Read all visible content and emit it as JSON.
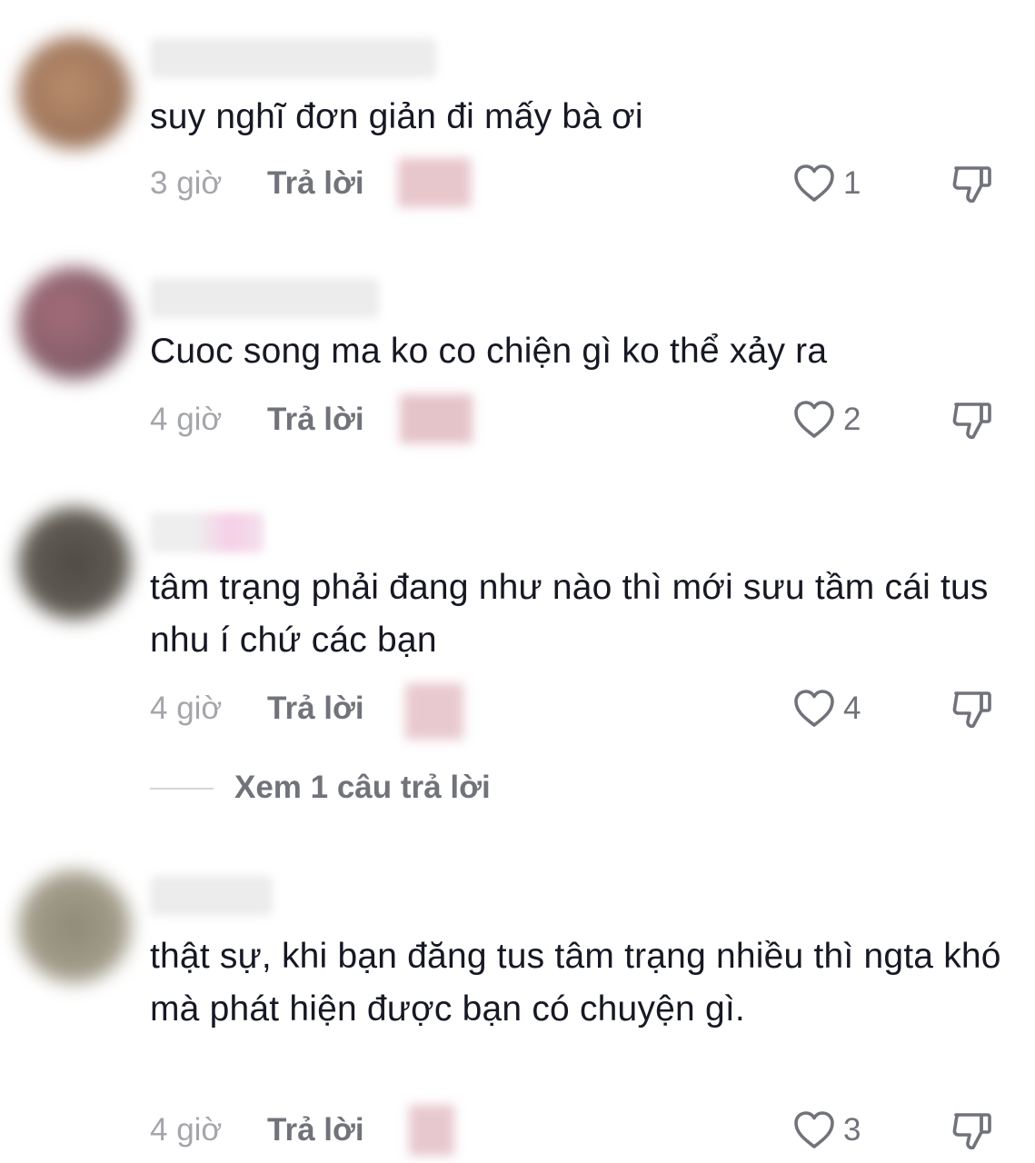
{
  "comments": [
    {
      "text": "suy nghĩ đơn giản đi mấy bà ơi",
      "time": "3 giờ",
      "reply_label": "Trả lời",
      "likes": "1"
    },
    {
      "text": "Cuoc song ma ko co chiện gì ko thể xảy ra",
      "time": "4 giờ",
      "reply_label": "Trả lời",
      "likes": "2"
    },
    {
      "text": "tâm trạng phải đang như nào thì mới sưu tầm cái tus nhu í chứ các bạn",
      "time": "4 giờ",
      "reply_label": "Trả lời",
      "likes": "4",
      "view_replies": "Xem 1 câu trả lời"
    },
    {
      "text": "thật sự, khi bạn đăng tus tâm trạng nhiều thì ngta khó mà phát hiện được bạn có chuyện gì.",
      "time": "4 giờ",
      "reply_label": "Trả lời",
      "likes": "3"
    }
  ],
  "colors": {
    "text": "#161823",
    "muted": "#a5a6ab",
    "action": "#71737a"
  },
  "icons": {
    "like": "heart-outline-icon",
    "dislike": "thumbs-down-icon"
  }
}
